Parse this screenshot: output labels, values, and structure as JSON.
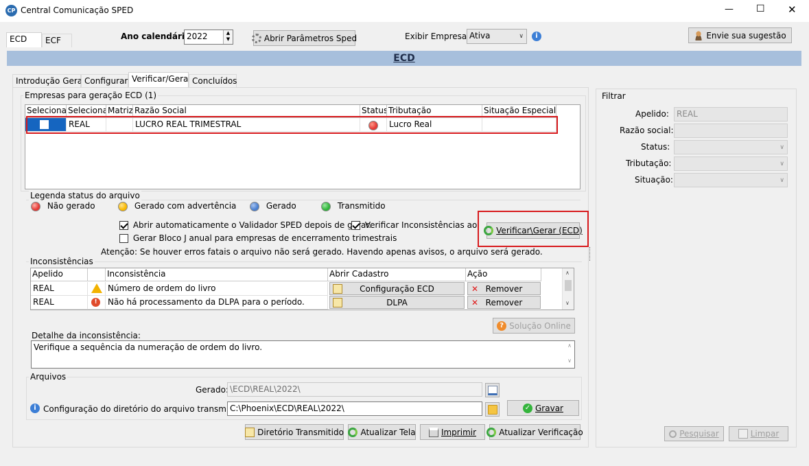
{
  "window": {
    "title": "Central Comunicação SPED",
    "logo_text": "CP",
    "minimize": "—",
    "maximize": "☐",
    "close": "✕"
  },
  "top_tabs": [
    {
      "label": "ECD"
    },
    {
      "label": "ECF"
    }
  ],
  "toolbar": {
    "year_label": "Ano calendário:",
    "year_value": "2022",
    "params_button": "Abrir Parâmetros Sped",
    "show_companies_label": "Exibir Empresas:",
    "show_companies_value": "Ativa",
    "suggestion_button": "Envie sua sugestão"
  },
  "section_header": "ECD",
  "sub_tabs": [
    {
      "label": "Introdução Geral"
    },
    {
      "label": "Configurar"
    },
    {
      "label": "Verificar/Gerar"
    },
    {
      "label": "Concluídos"
    }
  ],
  "companies": {
    "group_title": "Empresas para geração ECD (1)",
    "columns": [
      "Selecionar",
      "Selecionar",
      "Matriz",
      "Razão Social",
      "Status",
      "Tributação",
      "Situação Especial"
    ],
    "rows": [
      {
        "apelido": "REAL",
        "matriz": "",
        "razao": "LUCRO REAL TRIMESTRAL",
        "tributacao": "Lucro Real",
        "situacao": ""
      }
    ]
  },
  "legend": {
    "title": "Legenda status do arquivo",
    "items": [
      {
        "label": "Não gerado",
        "color": "#e53935"
      },
      {
        "label": "Gerado com advertência",
        "color": "#f9b800"
      },
      {
        "label": "Gerado",
        "color": "#4a7fd0"
      },
      {
        "label": "Transmitido",
        "color": "#2fb53a"
      }
    ]
  },
  "options": {
    "auto_validator": "Abrir automaticamente o Validador SPED depois de gerar.",
    "check_inconsistencies": "Verificar Inconsistências ao gerar",
    "bloco_j": "Gerar Bloco J anual para empresas de encerramento trimestrais",
    "attention": "Atenção: Se houver erros fatais o arquivo não será gerado. Havendo apenas avisos, o arquivo será gerado.",
    "verify_button": "Verificar\\Gerar (ECD)"
  },
  "inconsistencies": {
    "title": "Inconsistências",
    "columns": [
      "Apelido",
      "Inconsistência",
      "Abrir Cadastro",
      "Ação"
    ],
    "rows": [
      {
        "apelido": "REAL",
        "texto": "Número de ordem do livro",
        "cadastro": "Configuração ECD",
        "acao": "Remover",
        "level": "warning"
      },
      {
        "apelido": "REAL",
        "texto": "Não há processamento da DLPA para o período.",
        "cadastro": "DLPA",
        "acao": "Remover",
        "level": "error"
      }
    ],
    "online_button": "Solução Online",
    "detail_label": "Detalhe da inconsistência:",
    "detail_text": "Verifique a sequência da numeração de ordem do livro."
  },
  "files": {
    "title": "Arquivos",
    "generated_label": "Gerado:",
    "generated_value": "\\ECD\\REAL\\2022\\",
    "config_label": "Configuração do diretório do arquivo transmitido:",
    "config_value": "C:\\Phoenix\\ECD\\REAL\\2022\\",
    "save_button": "Gravar"
  },
  "bottom_buttons": {
    "dir": "Diretório Transmitido",
    "refresh": "Atualizar Tela",
    "print": "Imprimir",
    "update": "Atualizar Verificação"
  },
  "filter": {
    "title": "Filtrar",
    "apelido_label": "Apelido:",
    "apelido_value": "REAL",
    "razao_label": "Razão social:",
    "status_label": "Status:",
    "tributacao_label": "Tributação:",
    "situacao_label": "Situação:",
    "search_button": "Pesquisar",
    "clear_button": "Limpar"
  }
}
